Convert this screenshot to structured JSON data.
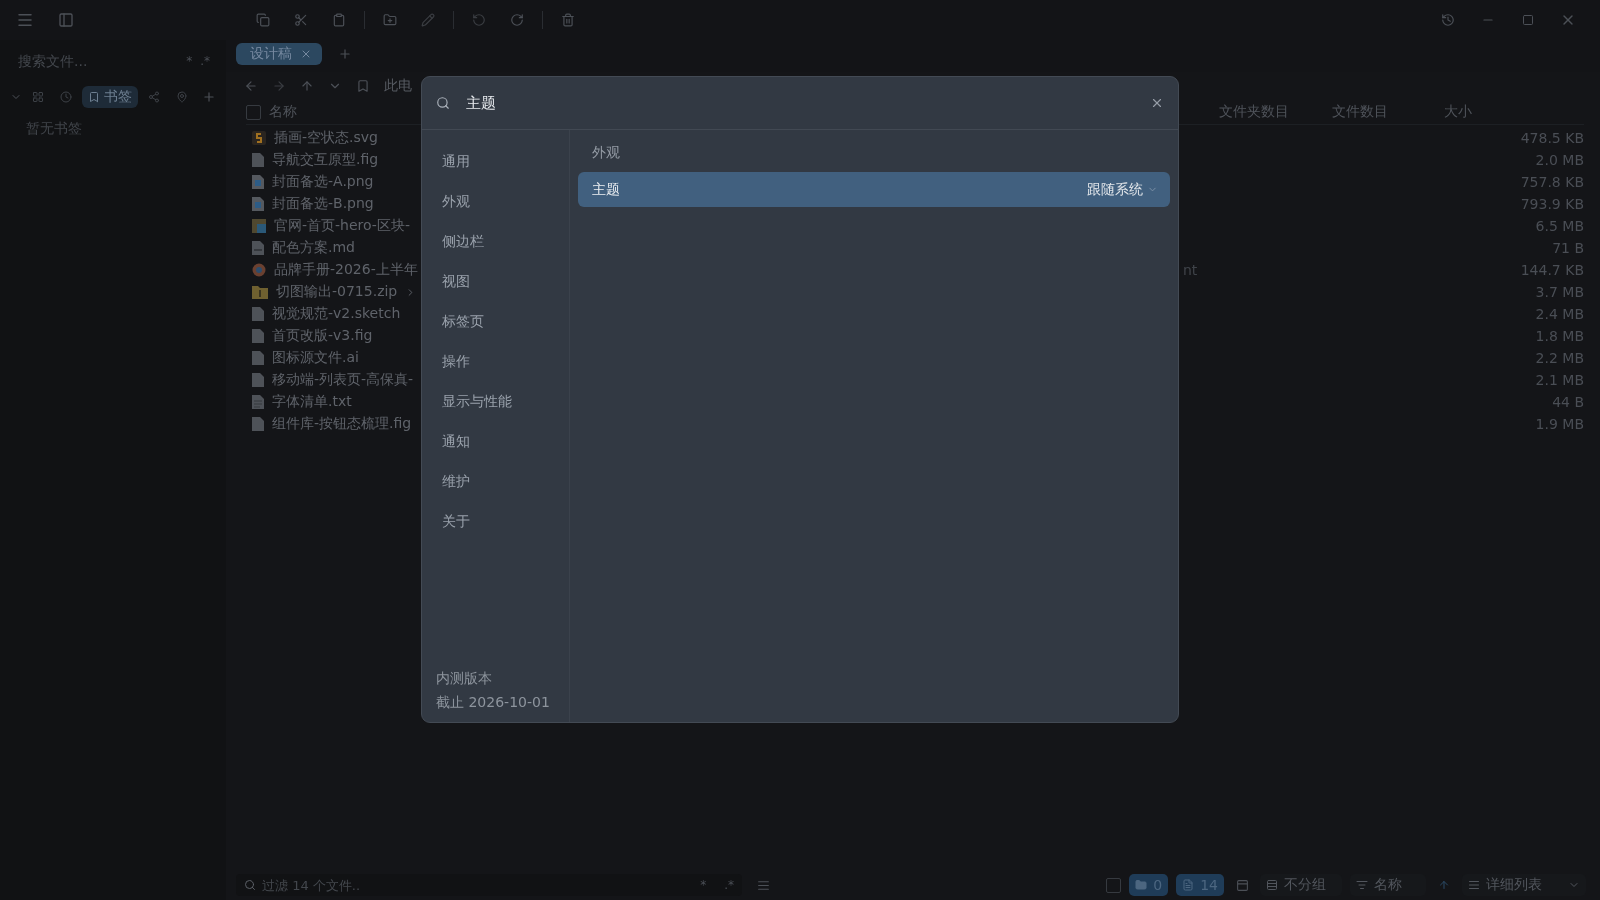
{
  "sidebar": {
    "search": {
      "placeholder": "搜索文件..."
    },
    "search_options": [
      "*",
      ".*"
    ],
    "bookmark_tabs": [
      {
        "kind": "grid",
        "selected": false
      },
      {
        "kind": "clock",
        "selected": false
      },
      {
        "kind": "bookmark",
        "label": "书签",
        "selected": true
      },
      {
        "kind": "nodes",
        "selected": false
      },
      {
        "kind": "pin",
        "selected": false
      }
    ],
    "empty_text": "暂无书签"
  },
  "tabs": [
    {
      "label": "设计稿",
      "selected": true
    }
  ],
  "breadcrumb": "此电",
  "table": {
    "select_all": {
      "checked": false
    },
    "columns": [
      "名称",
      "文件夹数目",
      "文件数目",
      "大小"
    ],
    "rows": [
      {
        "kind": "svg",
        "name": "插画-空状态.svg",
        "size": "478.5 KB"
      },
      {
        "kind": "file",
        "name": "导航交互原型.fig",
        "size": "2.0 MB"
      },
      {
        "kind": "image",
        "name": "封面备选-A.png",
        "size": "757.8 KB"
      },
      {
        "kind": "image",
        "name": "封面备选-B.png",
        "size": "793.9 KB"
      },
      {
        "kind": "psd",
        "name": "官网-首页-hero-区块-",
        "size": "6.5 MB"
      },
      {
        "kind": "md",
        "name": "配色方案.md",
        "size": "71 B"
      },
      {
        "kind": "web",
        "name": "品牌手册-2026-上半年",
        "column_2": "nt",
        "size": "144.7 KB"
      },
      {
        "kind": "zip",
        "name": "切图输出-0715.zip",
        "expandable": true,
        "size": "3.7 MB"
      },
      {
        "kind": "file",
        "name": "视觉规范-v2.sketch",
        "size": "2.4 MB"
      },
      {
        "kind": "file",
        "name": "首页改版-v3.fig",
        "size": "1.8 MB"
      },
      {
        "kind": "file",
        "name": "图标源文件.ai",
        "size": "2.2 MB"
      },
      {
        "kind": "file",
        "name": "移动端-列表页-高保真-",
        "size": "2.1 MB"
      },
      {
        "kind": "text",
        "name": "字体清单.txt",
        "size": "44 B"
      },
      {
        "kind": "file",
        "name": "组件库-按钮态梳理.fig",
        "size": "1.9 MB"
      }
    ]
  },
  "status_bar": {
    "select_all": {
      "checked": false
    },
    "filter": {
      "placeholder": "过滤 14 个文件.."
    },
    "filter_options": [
      "*",
      ".*"
    ],
    "folder_count": "0",
    "file_count": "14",
    "grouping": "不分组",
    "sort": "名称",
    "view": "详细列表"
  },
  "settings_dialog": {
    "search": {
      "value": "主题"
    },
    "nav": [
      {
        "label": "通用",
        "selected": false
      },
      {
        "label": "外观",
        "selected": false
      },
      {
        "label": "侧边栏",
        "selected": false
      },
      {
        "label": "视图",
        "selected": false
      },
      {
        "label": "标签页",
        "selected": false
      },
      {
        "label": "操作",
        "selected": false
      },
      {
        "label": "显示与性能",
        "selected": false
      },
      {
        "label": "通知",
        "selected": false
      },
      {
        "label": "维护",
        "selected": false
      },
      {
        "label": "关于",
        "selected": false
      }
    ],
    "footer": [
      "内测版本",
      "截止 2026-10-01"
    ],
    "section": "外观",
    "results": [
      {
        "label": "主题",
        "value": "跟随系统",
        "selected": true
      }
    ]
  }
}
